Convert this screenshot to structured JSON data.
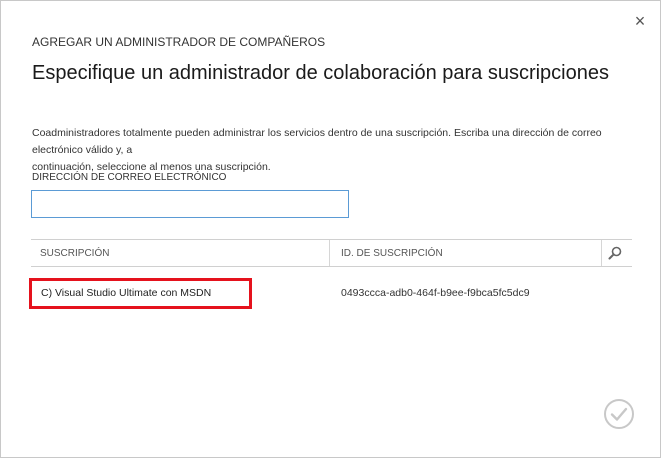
{
  "dialog": {
    "header": "AGREGAR UN ADMINISTRADOR DE COMPAÑEROS",
    "title": "Especifique un administrador de colaboración para suscripciones",
    "description_line1": "Coadministradores totalmente pueden administrar los servicios dentro de una suscripción. Escriba una dirección de correo electrónico válido y, a",
    "description_line2": "continuación, seleccione al menos una suscripción.",
    "close_glyph": "×"
  },
  "email": {
    "label": "DIRECCIÓN DE CORREO ELECTRÓNICO",
    "value": ""
  },
  "table": {
    "columns": [
      "SUSCRIPCIÓN",
      "ID. DE SUSCRIPCIÓN"
    ],
    "rows": [
      {
        "name": "C) Visual Studio Ultimate con MSDN",
        "id": "0493ccca-adb0-464f-b9ee-f9bca5fc5dc9"
      }
    ]
  },
  "colors": {
    "highlight": "#e5121d",
    "input_border": "#5b9bd5",
    "check_disabled": "#c8c8c8"
  },
  "icons": {
    "close": "close-icon",
    "search": "search-icon",
    "confirm": "checkmark-icon"
  }
}
